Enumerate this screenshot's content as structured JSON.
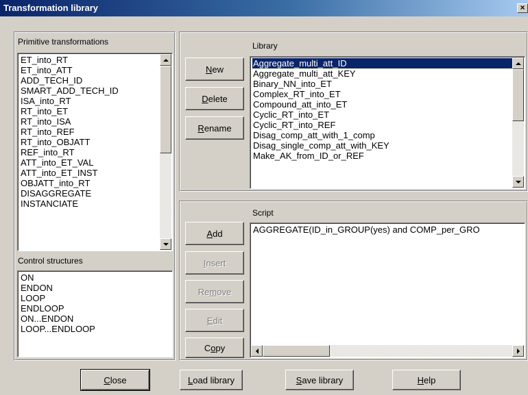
{
  "window": {
    "title": "Transformation library",
    "close_glyph": "×"
  },
  "primitive": {
    "label": "Primitive transformations",
    "items": [
      "ET_into_RT",
      "ET_into_ATT",
      "ADD_TECH_ID",
      "SMART_ADD_TECH_ID",
      "ISA_into_RT",
      "RT_into_ET",
      "RT_into_ISA",
      "RT_into_REF",
      "RT_into_OBJATT",
      "REF_into_RT",
      "ATT_into_ET_VAL",
      "ATT_into_ET_INST",
      "OBJATT_into_RT",
      "DISAGGREGATE",
      "INSTANCIATE"
    ]
  },
  "control": {
    "label": "Control structures",
    "items": [
      "ON",
      "ENDON",
      "LOOP",
      "ENDLOOP",
      "ON...ENDON",
      "LOOP...ENDLOOP"
    ]
  },
  "library": {
    "label": "Library",
    "selected_index": 0,
    "items": [
      "Aggregate_multi_att_ID",
      "Aggregate_multi_att_KEY",
      "Binary_NN_into_ET",
      "Complex_RT_into_ET",
      "Compound_att_into_ET",
      "Cyclic_RT_into_ET",
      "Cyclic_RT_into_REF",
      "Disag_comp_att_with_1_comp",
      "Disag_single_comp_att_with_KEY",
      "Make_AK_from_ID_or_REF"
    ],
    "buttons": {
      "new": {
        "mnemonic": "N",
        "rest": "ew"
      },
      "delete": {
        "mnemonic": "D",
        "rest": "elete"
      },
      "rename": {
        "mnemonic": "R",
        "rest": "ename"
      }
    }
  },
  "script": {
    "label": "Script",
    "text": "AGGREGATE(ID_in_GROUP(yes) and COMP_per_GRO",
    "buttons": {
      "add": {
        "mnemonic": "A",
        "rest": "dd"
      },
      "insert": {
        "mnemonic": "I",
        "rest": "nsert"
      },
      "remove_pre": "Re",
      "remove_mnemonic": "m",
      "remove_post": "ove",
      "edit": {
        "mnemonic": "E",
        "rest": "dit"
      },
      "copy_pre": "C",
      "copy_mnemonic": "o",
      "copy_post": "py"
    }
  },
  "footer": {
    "close": {
      "mnemonic": "C",
      "rest": "lose"
    },
    "load": {
      "mnemonic": "L",
      "rest": "oad library"
    },
    "save": {
      "mnemonic": "S",
      "rest": "ave library"
    },
    "help": {
      "mnemonic": "H",
      "rest": "elp"
    }
  }
}
